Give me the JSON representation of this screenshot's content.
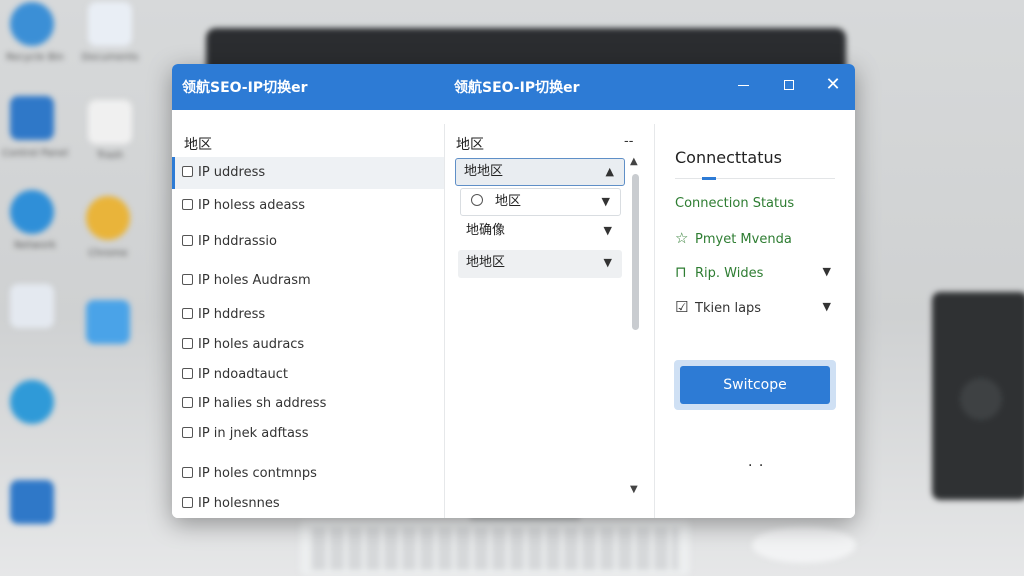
{
  "desktop": {
    "icons": [
      {
        "label": "Recycle Bin",
        "color": "#3b8fd6"
      },
      {
        "label": "Documents",
        "color": "#e9eef5"
      },
      {
        "label": "Control Panel",
        "color": "#2f78c8"
      },
      {
        "label": "Trash",
        "color": "#f0f0f0"
      },
      {
        "label": "Network",
        "color": "#2f8fd8"
      },
      {
        "label": "Chrome",
        "color": "#e9b43a"
      }
    ]
  },
  "window": {
    "title_left": "领航SEO-IP切换er",
    "title_center": "领航SEO-IP切换er",
    "accent_color": "#2d7bd5"
  },
  "left_panel": {
    "heading": "地区",
    "rows": [
      "IP uddress",
      "IP holess adeass",
      "IP hddrassio",
      "IP holes Audrasm",
      "IP hddress",
      "IP holes audracs",
      "IP ndoadtauct",
      "IP halies sh address",
      "IP in jnek adftass",
      "IP holes contmnps",
      "IP holesnnes"
    ]
  },
  "middle_panel": {
    "heading": "地区",
    "more": "--",
    "dropdowns": [
      "地地区",
      "地区",
      "地确像",
      "地地区"
    ]
  },
  "right_panel": {
    "title": "Connecttatus",
    "status_label": "Connection Status",
    "items": [
      {
        "icon": "star-icon",
        "label": "Pmyet Mvenda"
      },
      {
        "icon": "lock-icon",
        "label": "Rip. Wides"
      },
      {
        "icon": "check-box-icon",
        "label": "Tkien laps"
      }
    ],
    "switch_button": "Switcope",
    "ellipsis": ". ."
  }
}
